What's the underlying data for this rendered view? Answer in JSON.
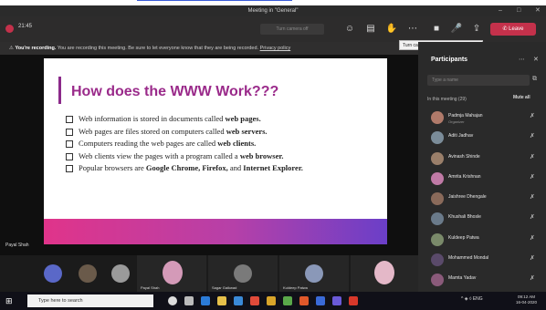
{
  "window": {
    "title": "Meeting in \"General\""
  },
  "toolbar": {
    "timer": "21:45",
    "blur_label": "Turn camera off",
    "leave_label": "Leave"
  },
  "banner": {
    "lead": "You're recording.",
    "text": "You are recording this meeting. Be sure to let everyone know that they are being recorded.",
    "link": "Privacy policy",
    "tooltip": "Turn camera off (Ctrl+Shift+O)"
  },
  "slide": {
    "title": "How does the WWW Work???",
    "bullets": [
      {
        "pre": "Web information is stored in documents called ",
        "bold": "web pages.",
        "post": ""
      },
      {
        "pre": "Web pages are files stored on computers called ",
        "bold": "web servers.",
        "post": ""
      },
      {
        "pre": "Computers reading the web pages are called ",
        "bold": "web clients.",
        "post": ""
      },
      {
        "pre": "Web clients view the pages with a program called a ",
        "bold": "web browser.",
        "post": ""
      },
      {
        "pre": "Popular browsers are ",
        "bold": "Google Chrome, Firefox,",
        "post": " and ",
        "bold2": "Internet Explorer."
      }
    ],
    "presenter": "Payal Shah"
  },
  "participants": {
    "title": "Participants",
    "invite_placeholder": "Type a name",
    "section_label": "In this meeting (29)",
    "mute_all": "Mute all",
    "people": [
      {
        "name": "Padmja Mahajan",
        "role": "Organizer",
        "color": "#b07a6a"
      },
      {
        "name": "Aditi Jadhav",
        "role": "",
        "color": "#7b8c99"
      },
      {
        "name": "Avinash Shinde",
        "role": "",
        "color": "#9a7f6a"
      },
      {
        "name": "Amrita Krishnan",
        "role": "",
        "color": "#c07aa6"
      },
      {
        "name": "Jaishree Dhengale",
        "role": "",
        "color": "#8a6a5a"
      },
      {
        "name": "Khushali Bhosle",
        "role": "",
        "color": "#6a7a8a"
      },
      {
        "name": "Kuldeep Patwa",
        "role": "",
        "color": "#7a8a6a"
      },
      {
        "name": "Mohammed Mondal",
        "role": "",
        "color": "#5a4a6a"
      },
      {
        "name": "Mamta Yadav",
        "role": "",
        "color": "#8a5a7a"
      }
    ]
  },
  "video_strip": {
    "tiles": [
      {
        "name": "",
        "color": "#5a68c8"
      },
      {
        "name": "",
        "color": "#6a5a4a"
      },
      {
        "name": "",
        "color": "#9a9a9a"
      },
      {
        "name": "Payal Shah",
        "color": "#d49ab8"
      },
      {
        "name": "Sagar Gaikwad",
        "color": "#7a7a7a"
      },
      {
        "name": "Kuldeep Patwa",
        "color": "#8a98b8"
      },
      {
        "name": "",
        "color": "#e4b8c8"
      }
    ]
  },
  "taskbar": {
    "search_placeholder": "Type here to search",
    "tray_text": "ENG",
    "time": "09:12 AM",
    "date": "16-04-2020"
  }
}
